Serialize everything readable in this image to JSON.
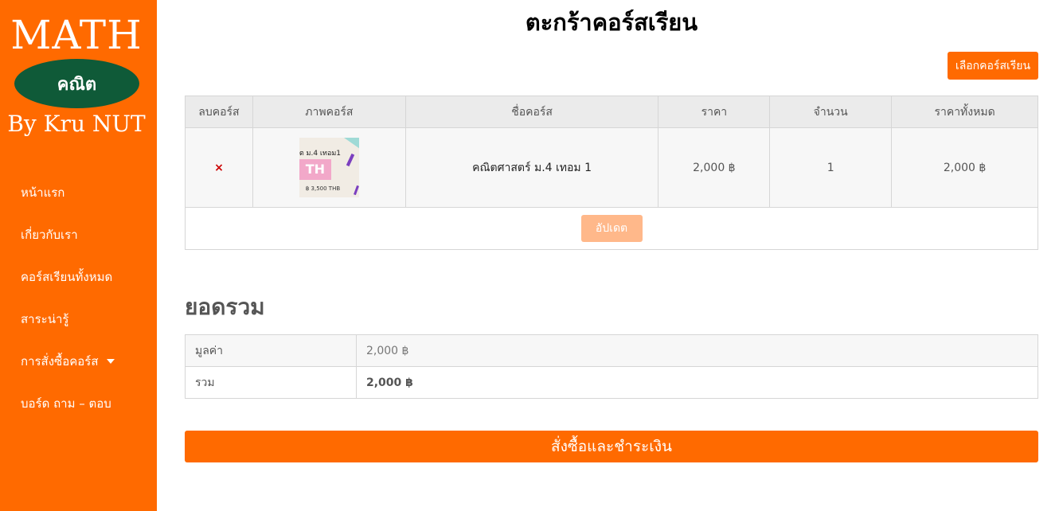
{
  "sidebar": {
    "logo": {
      "title": "MATH",
      "badge": "คณิต",
      "byline": "By Kru NUT"
    },
    "items": [
      {
        "label": "หน้าแรก"
      },
      {
        "label": "เกี่ยวกับเรา"
      },
      {
        "label": "คอร์สเรียนทั้งหมด"
      },
      {
        "label": "สาระน่ารู้"
      },
      {
        "label": "การสั่งซื้อคอร์ส",
        "icon": "chevron-down-icon"
      },
      {
        "label": "บอร์ด ถาม – ตอบ"
      }
    ]
  },
  "main": {
    "title": "ตะกร้าคอร์สเรียน",
    "choose_button": "เลือกคอร์สเรียน",
    "cart": {
      "headers": [
        "ลบคอร์ส",
        "ภาพคอร์ส",
        "ชื่อคอร์ส",
        "ราคา",
        "จำนวน",
        "ราคาทั้งหมด"
      ],
      "rows": [
        {
          "remove": "×",
          "thumbnail": {
            "line1": "ต ม.4 เทอม1",
            "big": "TH",
            "price": "฿ 3,500 THB"
          },
          "name": "คณิตศาสตร์ ม.4 เทอม 1",
          "price": "2,000 ฿",
          "quantity": "1",
          "subtotal": "2,000 ฿"
        }
      ],
      "update_button": "อัปเดต"
    },
    "totals": {
      "heading": "ยอดรวม",
      "rows": [
        {
          "label": "มูลค่า",
          "value": "2,000 ฿"
        },
        {
          "label": "รวม",
          "value": "2,000 ฿"
        }
      ]
    },
    "checkout_button": "สั่งซื้อและชำระเงิน"
  },
  "colors": {
    "accent": "#ff6a00",
    "logo_badge": "#0f5a38",
    "remove": "#cc0000",
    "update_disabled": "#ffb88a"
  }
}
